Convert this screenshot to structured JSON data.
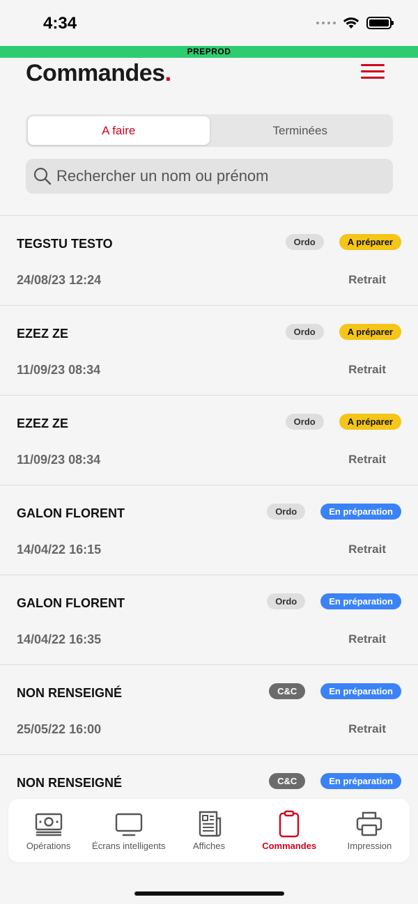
{
  "status_bar": {
    "time": "4:34"
  },
  "env_banner": "PREPROD",
  "header": {
    "title": "Commandes",
    "title_dot": "."
  },
  "segments": [
    {
      "label": "A faire",
      "active": true
    },
    {
      "label": "Terminées",
      "active": false
    }
  ],
  "search": {
    "placeholder": "Rechercher un nom ou prénom",
    "value": ""
  },
  "orders": [
    {
      "name": "TEGSTU TESTO",
      "type": "Ordo",
      "status": "A préparer",
      "date": "24/08/23 12:24",
      "mode": "Retrait"
    },
    {
      "name": "EZEZ ZE",
      "type": "Ordo",
      "status": "A préparer",
      "date": "11/09/23 08:34",
      "mode": "Retrait"
    },
    {
      "name": "EZEZ ZE",
      "type": "Ordo",
      "status": "A préparer",
      "date": "11/09/23 08:34",
      "mode": "Retrait"
    },
    {
      "name": "GALON FLORENT",
      "type": "Ordo",
      "status": "En préparation",
      "date": "14/04/22 16:15",
      "mode": "Retrait"
    },
    {
      "name": "GALON FLORENT",
      "type": "Ordo",
      "status": "En préparation",
      "date": "14/04/22 16:35",
      "mode": "Retrait"
    },
    {
      "name": "NON RENSEIGNÉ",
      "type": "C&C",
      "status": "En préparation",
      "date": "25/05/22 16:00",
      "mode": "Retrait"
    },
    {
      "name": "NON RENSEIGNÉ",
      "type": "C&C",
      "status": "En préparation",
      "date": "",
      "mode": ""
    }
  ],
  "tabs": [
    {
      "label": "Opérations",
      "icon": "banknote-icon",
      "active": false
    },
    {
      "label": "Écrans intelligents",
      "icon": "monitor-icon",
      "active": false
    },
    {
      "label": "Affiches",
      "icon": "newspaper-icon",
      "active": false
    },
    {
      "label": "Commandes",
      "icon": "clipboard-icon",
      "active": true
    },
    {
      "label": "Impression",
      "icon": "printer-icon",
      "active": false
    }
  ],
  "colors": {
    "accent": "#d0021b",
    "banner": "#2ecc71",
    "status_a_preparer": "#f5c518",
    "status_en_preparation": "#3b82f6"
  }
}
